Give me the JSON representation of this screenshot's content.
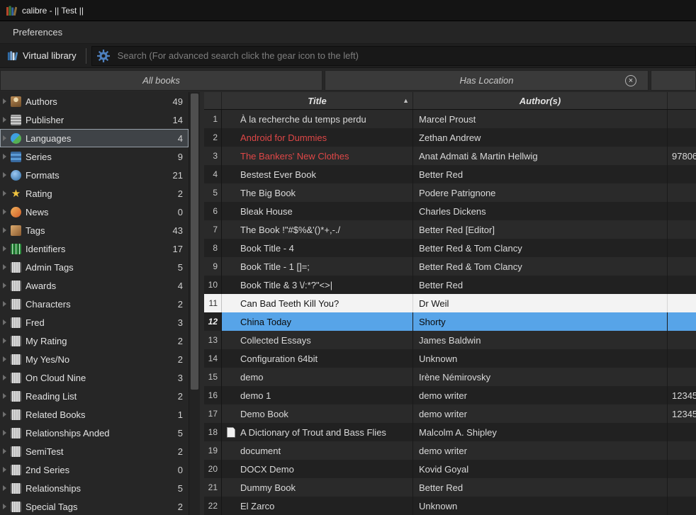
{
  "window": {
    "title": "calibre - || Test ||"
  },
  "menu": {
    "preferences": "Preferences"
  },
  "toolbar": {
    "virtual_library_label": "Virtual library",
    "search_placeholder": "Search (For advanced search click the gear icon to the left)"
  },
  "tabs": {
    "all_books": "All books",
    "has_location": "Has Location",
    "close_glyph": "×"
  },
  "sidebar": {
    "items": [
      {
        "label": "Authors",
        "count": "49",
        "icon": "authors"
      },
      {
        "label": "Publisher",
        "count": "14",
        "icon": "publisher"
      },
      {
        "label": "Languages",
        "count": "4",
        "icon": "languages",
        "selected": true
      },
      {
        "label": "Series",
        "count": "9",
        "icon": "series"
      },
      {
        "label": "Formats",
        "count": "21",
        "icon": "formats"
      },
      {
        "label": "Rating",
        "count": "2",
        "icon": "rating"
      },
      {
        "label": "News",
        "count": "0",
        "icon": "news"
      },
      {
        "label": "Tags",
        "count": "43",
        "icon": "tags"
      },
      {
        "label": "Identifiers",
        "count": "17",
        "icon": "identifiers"
      },
      {
        "label": "Admin Tags",
        "count": "5",
        "icon": "custom-column"
      },
      {
        "label": "Awards",
        "count": "4",
        "icon": "custom-column"
      },
      {
        "label": "Characters",
        "count": "2",
        "icon": "custom-column"
      },
      {
        "label": "Fred",
        "count": "3",
        "icon": "custom-column"
      },
      {
        "label": "My Rating",
        "count": "2",
        "icon": "custom-column"
      },
      {
        "label": "My Yes/No",
        "count": "2",
        "icon": "custom-column"
      },
      {
        "label": "On Cloud Nine",
        "count": "3",
        "icon": "custom-column"
      },
      {
        "label": "Reading List",
        "count": "2",
        "icon": "custom-column"
      },
      {
        "label": "Related Books",
        "count": "1",
        "icon": "custom-column"
      },
      {
        "label": "Relationships Anded",
        "count": "5",
        "icon": "custom-column"
      },
      {
        "label": "SemiTest",
        "count": "2",
        "icon": "custom-column"
      },
      {
        "label": "2nd Series",
        "count": "0",
        "icon": "custom-column"
      },
      {
        "label": "Relationships",
        "count": "5",
        "icon": "custom-column"
      },
      {
        "label": "Special Tags",
        "count": "2",
        "icon": "custom-column"
      }
    ]
  },
  "table": {
    "columns": {
      "title": "Title",
      "authors": "Author(s)"
    },
    "sort_indicator": "▲",
    "rows": [
      {
        "num": "1",
        "title": "À la recherche du temps perdu",
        "authors": "Marcel Proust"
      },
      {
        "num": "2",
        "title": "Android for Dummies",
        "authors": "Zethan Andrew",
        "title_color": "red"
      },
      {
        "num": "3",
        "title": "The Bankers' New Clothes",
        "authors": "Anat Admati & Martin Hellwig",
        "title_color": "red",
        "extra": "97806"
      },
      {
        "num": "4",
        "title": "Bestest Ever Book",
        "authors": "Better Red"
      },
      {
        "num": "5",
        "title": "The Big Book",
        "authors": "Podere Patrignone"
      },
      {
        "num": "6",
        "title": "Bleak House",
        "authors": "Charles Dickens"
      },
      {
        "num": "7",
        "title": "The Book !\"#$%&'()*+,-./",
        "authors": "Better Red [Editor]"
      },
      {
        "num": "8",
        "title": "Book Title - 4",
        "authors": "Better Red & Tom Clancy"
      },
      {
        "num": "9",
        "title": "Book Title - 1 []=;",
        "authors": "Better Red & Tom Clancy"
      },
      {
        "num": "10",
        "title": "Book Title & 3 \\/:*?\"<>|",
        "authors": "Better Red"
      },
      {
        "num": "11",
        "title": "Can Bad Teeth Kill You?",
        "authors": "Dr Weil",
        "state": "highlighted"
      },
      {
        "num": "12",
        "title": "China Today",
        "authors": "Shorty",
        "state": "selected"
      },
      {
        "num": "13",
        "title": "Collected Essays",
        "authors": "James Baldwin"
      },
      {
        "num": "14",
        "title": "Configuration 64bit",
        "authors": "Unknown"
      },
      {
        "num": "15",
        "title": "demo",
        "authors": "Irène Némirovsky"
      },
      {
        "num": "16",
        "title": "demo 1",
        "authors": "demo writer",
        "extra": "12345"
      },
      {
        "num": "17",
        "title": "Demo Book",
        "authors": "demo writer",
        "extra": "12345"
      },
      {
        "num": "18",
        "title": "A Dictionary of Trout and Bass Flies",
        "authors": "Malcolm A. Shipley",
        "file_icon": true
      },
      {
        "num": "19",
        "title": "document",
        "authors": "demo writer"
      },
      {
        "num": "20",
        "title": "DOCX Demo",
        "authors": "Kovid Goyal"
      },
      {
        "num": "21",
        "title": "Dummy Book",
        "authors": "Better Red"
      },
      {
        "num": "22",
        "title": "El Zarco",
        "authors": "Unknown"
      }
    ]
  },
  "colors": {
    "selection": "#57a4e8",
    "marked_title": "#df4747",
    "highlight_row": "#f3f3f3"
  }
}
